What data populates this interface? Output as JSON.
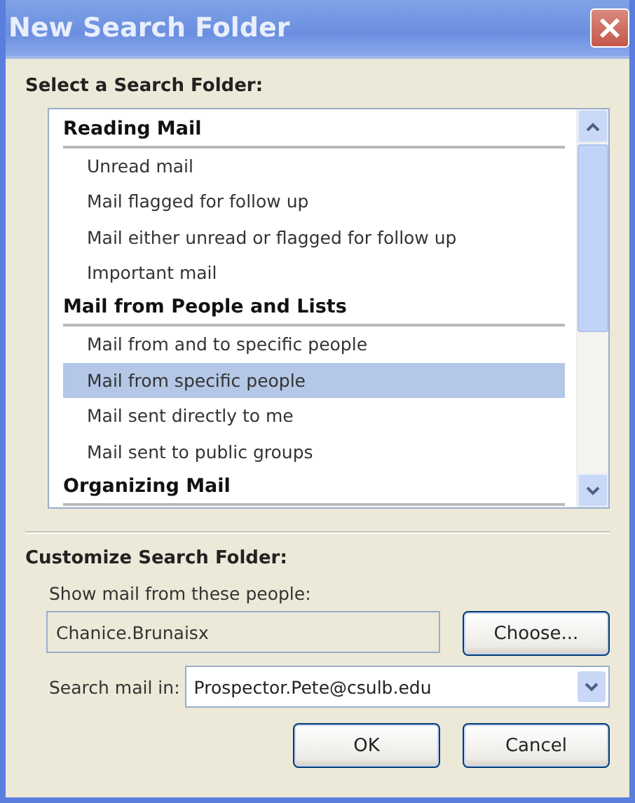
{
  "window": {
    "title": "New Search Folder"
  },
  "select_heading": "Select a Search Folder:",
  "folder_groups": [
    {
      "label": "Reading Mail",
      "items": [
        {
          "label": "Unread mail",
          "selected": false
        },
        {
          "label": "Mail flagged for follow up",
          "selected": false
        },
        {
          "label": "Mail either unread or flagged for follow up",
          "selected": false
        },
        {
          "label": "Important mail",
          "selected": false
        }
      ]
    },
    {
      "label": "Mail from People and Lists",
      "items": [
        {
          "label": "Mail from and to specific people",
          "selected": false
        },
        {
          "label": "Mail from specific people",
          "selected": true
        },
        {
          "label": "Mail sent directly to me",
          "selected": false
        },
        {
          "label": "Mail sent to public groups",
          "selected": false
        }
      ]
    },
    {
      "label": "Organizing Mail"
    }
  ],
  "customize": {
    "heading": "Customize Search Folder:",
    "people_label": "Show mail from these people:",
    "people_value": "Chanice.Brunaisx",
    "choose_button": "Choose...",
    "search_in_label": "Search mail in:",
    "search_in_value": "Prospector.Pete@csulb.edu"
  },
  "buttons": [
    "OK",
    "Cancel"
  ]
}
